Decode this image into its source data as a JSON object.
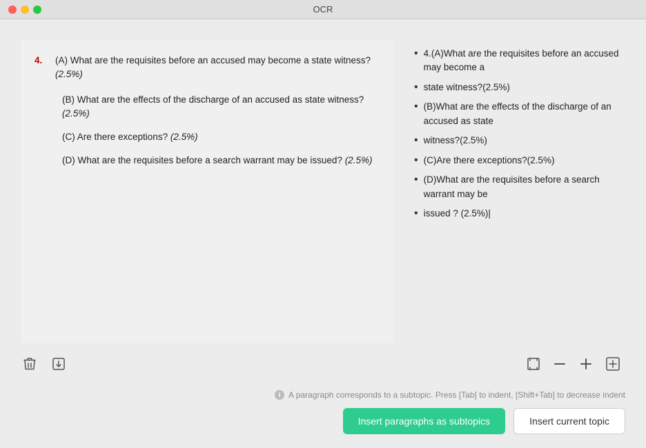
{
  "titlebar": {
    "title": "OCR",
    "buttons": [
      "close",
      "minimize",
      "maximize"
    ]
  },
  "left_panel": {
    "question_number": "4.",
    "sub_items": [
      {
        "label": "(A)",
        "text": "What are the requisites before an accused may become a state witness?",
        "points": "(2.5%)"
      },
      {
        "label": "(B)",
        "text": "What are the effects of the discharge of an accused as state witness?",
        "points": "(2.5%)"
      },
      {
        "label": "(C)",
        "text": "Are there exceptions?",
        "points": "(2.5%)"
      },
      {
        "label": "(D)",
        "text": "What are the requisites before a search warrant may be issued?",
        "points": "(2.5%)"
      }
    ]
  },
  "right_panel": {
    "bullets": [
      "4.(A)What are the requisites before an accused may become a",
      "state witness?(2.5%)",
      "(B)What are the effects of the discharge of an accused as state",
      "witness?(2.5%)",
      "(C)Are there exceptions?(2.5%)",
      "(D)What are the requisites before a search warrant may be",
      "issued ? (2.5%)"
    ]
  },
  "toolbar": {
    "delete_label": "🗑",
    "export_label": "⊡",
    "shrink_label": "⊟",
    "expand_frame_label": "⊞",
    "minus_label": "−",
    "plus_label": "+"
  },
  "footer": {
    "hint_text": "A paragraph corresponds to a subtopic. Press [Tab] to indent, [Shift+Tab] to decrease indent",
    "insert_paragraphs_label": "Insert paragraphs as subtopics",
    "insert_topic_label": "Insert current topic"
  }
}
